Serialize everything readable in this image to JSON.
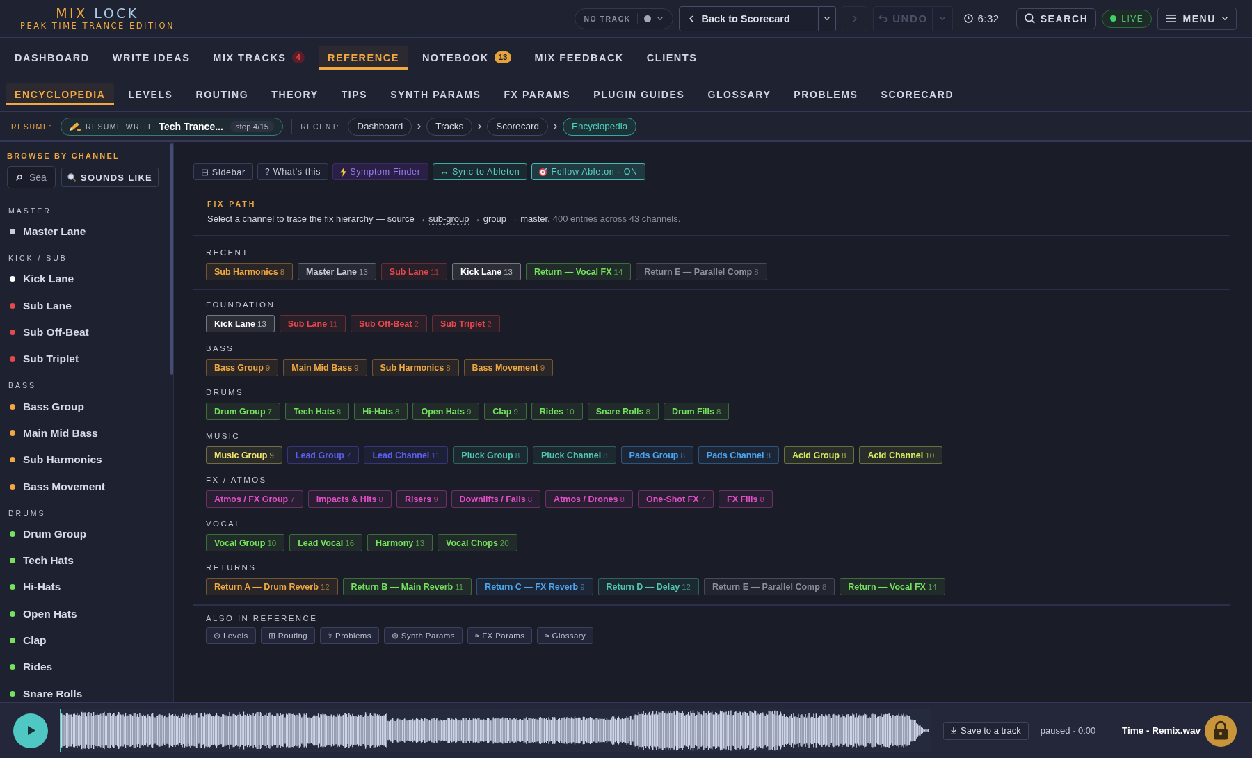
{
  "logo": {
    "title": [
      {
        "text": "MIX",
        "color": "#f0a840"
      },
      {
        "text": "LOCK",
        "color": "#a8cbe8"
      }
    ],
    "subtitle": "PEAK TIME TRANCE EDITION"
  },
  "track_picker": {
    "label": "NO TRACK"
  },
  "back_button": {
    "label": "Back to Scorecard"
  },
  "forward_button": {
    "disabled": true
  },
  "undo_button": {
    "label": "UNDO",
    "disabled": true
  },
  "timer": {
    "time": "6:32"
  },
  "search_button": {
    "label": "SEARCH"
  },
  "live_indicator": {
    "label": "LIVE",
    "on": true
  },
  "menu_button": {
    "label": "MENU"
  },
  "main_tabs": [
    {
      "label": "DASHBOARD",
      "selected": false
    },
    {
      "label": "WRITE IDEAS",
      "selected": false
    },
    {
      "label": "MIX TRACKS",
      "selected": false,
      "badge": {
        "text": "4",
        "kind": "alert"
      }
    },
    {
      "label": "REFERENCE",
      "selected": true
    },
    {
      "label": "NOTEBOOK",
      "selected": false,
      "badge": {
        "text": "13",
        "kind": "count"
      }
    },
    {
      "label": "MIX FEEDBACK",
      "selected": false
    },
    {
      "label": "CLIENTS",
      "selected": false
    }
  ],
  "sub_tabs": [
    {
      "label": "ENCYCLOPEDIA",
      "selected": true
    },
    {
      "label": "LEVELS",
      "selected": false
    },
    {
      "label": "ROUTING",
      "selected": false
    },
    {
      "label": "THEORY",
      "selected": false
    },
    {
      "label": "TIPS",
      "selected": false
    },
    {
      "label": "SYNTH PARAMS",
      "selected": false
    },
    {
      "label": "FX PARAMS",
      "selected": false
    },
    {
      "label": "PLUGIN GUIDES",
      "selected": false
    },
    {
      "label": "GLOSSARY",
      "selected": false
    },
    {
      "label": "PROBLEMS",
      "selected": false
    },
    {
      "label": "SCORECARD",
      "selected": false
    }
  ],
  "resume_bar": {
    "label": "RESUME:",
    "resume_button": {
      "action": "RESUME WRITE",
      "title": "Tech Trance...",
      "step": "step 4/15"
    },
    "recent_label": "RECENT:",
    "recent": [
      {
        "label": "Dashboard",
        "selected": false
      },
      {
        "label": "Tracks",
        "selected": false
      },
      {
        "label": "Scorecard",
        "selected": false
      },
      {
        "label": "Encyclopedia",
        "selected": true
      }
    ]
  },
  "sidebar": {
    "heading": "BROWSE BY CHANNEL",
    "search": {
      "placeholder": "Sea"
    },
    "sounds_like_button": "SOUNDS LIKE",
    "groups": [
      {
        "title": "MASTER",
        "items": [
          {
            "name": "Master Lane",
            "color": "#c9cdd8"
          }
        ]
      },
      {
        "title": "KICK / SUB",
        "items": [
          {
            "name": "Kick Lane",
            "color": "#ffffff"
          },
          {
            "name": "Sub Lane",
            "color": "#e5484d"
          },
          {
            "name": "Sub Off-Beat",
            "color": "#e5484d"
          },
          {
            "name": "Sub Triplet",
            "color": "#e5484d"
          }
        ]
      },
      {
        "title": "BASS",
        "items": [
          {
            "name": "Bass Group",
            "color": "#f0a840"
          },
          {
            "name": "Main Mid Bass",
            "color": "#f0a840"
          },
          {
            "name": "Sub Harmonics",
            "color": "#f0a840"
          },
          {
            "name": "Bass Movement",
            "color": "#f0a840"
          }
        ]
      },
      {
        "title": "DRUMS",
        "items": [
          {
            "name": "Drum Group",
            "color": "#74e35c"
          },
          {
            "name": "Tech Hats",
            "color": "#74e35c"
          },
          {
            "name": "Hi-Hats",
            "color": "#74e35c"
          },
          {
            "name": "Open Hats",
            "color": "#74e35c"
          },
          {
            "name": "Clap",
            "color": "#74e35c"
          },
          {
            "name": "Rides",
            "color": "#74e35c"
          },
          {
            "name": "Snare Rolls",
            "color": "#74e35c"
          }
        ]
      }
    ]
  },
  "toolbar": [
    {
      "label": "⊟ Sidebar",
      "kind": "plain"
    },
    {
      "label": "? What's this",
      "kind": "plain"
    },
    {
      "label": "Symptom Finder",
      "kind": "finder"
    },
    {
      "label": "↔ Sync to Ableton",
      "kind": "link"
    },
    {
      "label": "Follow Ableton · ON",
      "kind": "active"
    }
  ],
  "fix_path": {
    "label": "FIX PATH",
    "description": {
      "before": "Select a channel to trace the fix hierarchy — source →",
      "term": "sub-group",
      "after": "→ group → master."
    },
    "summary": "400 entries across 43 channels."
  },
  "recent": {
    "title": "RECENT",
    "channels": [
      {
        "name": "Sub Harmonics",
        "count": "8",
        "color": "#f0a840"
      },
      {
        "name": "Master Lane",
        "count": "13",
        "color": "#c9cdd8"
      },
      {
        "name": "Sub Lane",
        "count": "11",
        "color": "#e5484d"
      },
      {
        "name": "Kick Lane",
        "count": "13",
        "color": "#ffffff"
      },
      {
        "name": "Return — Vocal FX",
        "count": "14",
        "color": "#74e35c"
      },
      {
        "name": "Return E — Parallel Comp",
        "count": "8",
        "color": "#8b909e"
      }
    ]
  },
  "categories": [
    {
      "title": "FOUNDATION",
      "channels": [
        {
          "name": "Kick Lane",
          "count": "13",
          "color": "#ffffff"
        },
        {
          "name": "Sub Lane",
          "count": "11",
          "color": "#e5484d"
        },
        {
          "name": "Sub Off-Beat",
          "count": "2",
          "color": "#e5484d"
        },
        {
          "name": "Sub Triplet",
          "count": "2",
          "color": "#e5484d"
        }
      ]
    },
    {
      "title": "BASS",
      "channels": [
        {
          "name": "Bass Group",
          "count": "9",
          "color": "#f0a840"
        },
        {
          "name": "Main Mid Bass",
          "count": "9",
          "color": "#f0a840"
        },
        {
          "name": "Sub Harmonics",
          "count": "8",
          "color": "#f0a840"
        },
        {
          "name": "Bass Movement",
          "count": "9",
          "color": "#f0a840"
        }
      ]
    },
    {
      "title": "DRUMS",
      "channels": [
        {
          "name": "Drum Group",
          "count": "7",
          "color": "#74e35c"
        },
        {
          "name": "Tech Hats",
          "count": "8",
          "color": "#74e35c"
        },
        {
          "name": "Hi-Hats",
          "count": "8",
          "color": "#74e35c"
        },
        {
          "name": "Open Hats",
          "count": "9",
          "color": "#74e35c"
        },
        {
          "name": "Clap",
          "count": "9",
          "color": "#74e35c"
        },
        {
          "name": "Rides",
          "count": "10",
          "color": "#74e35c"
        },
        {
          "name": "Snare Rolls",
          "count": "8",
          "color": "#74e35c"
        },
        {
          "name": "Drum Fills",
          "count": "8",
          "color": "#74e35c"
        }
      ]
    },
    {
      "title": "MUSIC",
      "channels": [
        {
          "name": "Music Group",
          "count": "9",
          "color": "#f2e46a"
        },
        {
          "name": "Lead Group",
          "count": "7",
          "color": "#5b5ff0"
        },
        {
          "name": "Lead Channel",
          "count": "11",
          "color": "#5b5ff0"
        },
        {
          "name": "Pluck Group",
          "count": "8",
          "color": "#4fc6b2"
        },
        {
          "name": "Pluck Channel",
          "count": "8",
          "color": "#4fc6b2"
        },
        {
          "name": "Pads Group",
          "count": "8",
          "color": "#4aa6f0"
        },
        {
          "name": "Pads Channel",
          "count": "8",
          "color": "#4aa6f0"
        },
        {
          "name": "Acid Group",
          "count": "8",
          "color": "#d4ee5a"
        },
        {
          "name": "Acid Channel",
          "count": "10",
          "color": "#d4ee5a"
        }
      ]
    },
    {
      "title": "FX / ATMOS",
      "channels": [
        {
          "name": "Atmos / FX Group",
          "count": "7",
          "color": "#e24fc6"
        },
        {
          "name": "Impacts & Hits",
          "count": "8",
          "color": "#e24fc6"
        },
        {
          "name": "Risers",
          "count": "9",
          "color": "#e24fc6"
        },
        {
          "name": "Downlifts / Falls",
          "count": "8",
          "color": "#e24fc6"
        },
        {
          "name": "Atmos / Drones",
          "count": "8",
          "color": "#e24fc6"
        },
        {
          "name": "One-Shot FX",
          "count": "7",
          "color": "#e24fc6"
        },
        {
          "name": "FX Fills",
          "count": "8",
          "color": "#e24fc6"
        }
      ]
    },
    {
      "title": "VOCAL",
      "channels": [
        {
          "name": "Vocal Group",
          "count": "10",
          "color": "#74e35c"
        },
        {
          "name": "Lead Vocal",
          "count": "16",
          "color": "#74e35c"
        },
        {
          "name": "Harmony",
          "count": "13",
          "color": "#74e35c"
        },
        {
          "name": "Vocal Chops",
          "count": "20",
          "color": "#74e35c"
        }
      ]
    },
    {
      "title": "RETURNS",
      "channels": [
        {
          "name": "Return A — Drum Reverb",
          "count": "12",
          "color": "#f0a840"
        },
        {
          "name": "Return B — Main Reverb",
          "count": "11",
          "color": "#74e35c"
        },
        {
          "name": "Return C — FX Reverb",
          "count": "9",
          "color": "#4aa6f0"
        },
        {
          "name": "Return D — Delay",
          "count": "12",
          "color": "#4fc6b2"
        },
        {
          "name": "Return E — Parallel Comp",
          "count": "8",
          "color": "#8b909e"
        },
        {
          "name": "Return — Vocal FX",
          "count": "14",
          "color": "#74e35c"
        }
      ]
    }
  ],
  "also_in_reference": {
    "title": "ALSO IN REFERENCE",
    "links": [
      "⊙ Levels",
      "⊞ Routing",
      "⚕ Problems",
      "⊛ Synth Params",
      "≈ FX Params",
      "≈ Glossary"
    ]
  },
  "player": {
    "level": 0,
    "save_button": "Save to a track",
    "status": "paused · 0:00",
    "file_name": "Time - Remix.wav"
  }
}
